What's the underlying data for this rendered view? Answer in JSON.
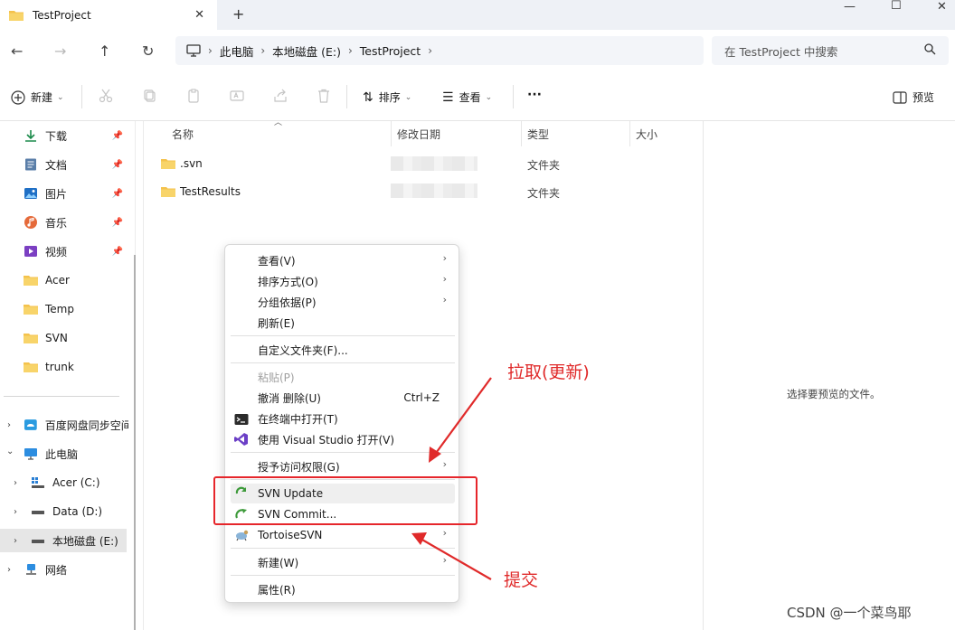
{
  "window": {
    "tab_title": "TestProject",
    "close_tab_glyph": "✕",
    "new_tab_glyph": "+",
    "minimize_glyph": "—",
    "maximize_glyph": "☐",
    "close_glyph": "✕"
  },
  "nav": {
    "back_glyph": "←",
    "forward_glyph": "→",
    "up_glyph": "↑",
    "refresh_glyph": "↻",
    "breadcrumbs": [
      "此电脑",
      "本地磁盘 (E:)",
      "TestProject"
    ],
    "search_placeholder": "在 TestProject 中搜索"
  },
  "toolbar": {
    "new_label": "新建",
    "sort_label": "排序",
    "view_label": "查看",
    "more_label": "···",
    "preview_label": "预览"
  },
  "sidebar": {
    "quick": [
      {
        "label": "下载",
        "icon": "download-icon",
        "pinned": true
      },
      {
        "label": "文档",
        "icon": "document-icon",
        "pinned": true
      },
      {
        "label": "图片",
        "icon": "pictures-icon",
        "pinned": true
      },
      {
        "label": "音乐",
        "icon": "music-icon",
        "pinned": true
      },
      {
        "label": "视频",
        "icon": "video-icon",
        "pinned": true
      },
      {
        "label": "Acer",
        "icon": "folder-icon",
        "pinned": false
      },
      {
        "label": "Temp",
        "icon": "folder-icon",
        "pinned": false
      },
      {
        "label": "SVN",
        "icon": "folder-icon",
        "pinned": false
      },
      {
        "label": "trunk",
        "icon": "folder-icon",
        "pinned": false
      }
    ],
    "tree": [
      {
        "label": "百度网盘同步空间",
        "icon": "cloud-sync-icon",
        "expander": "›"
      },
      {
        "label": "此电脑",
        "icon": "computer-icon",
        "expander": "⌄"
      },
      {
        "label": "Acer (C:)",
        "icon": "windows-drive-icon",
        "expander": "›"
      },
      {
        "label": "Data (D:)",
        "icon": "drive-icon",
        "expander": "›"
      },
      {
        "label": "本地磁盘 (E:)",
        "icon": "drive-icon",
        "expander": "›"
      },
      {
        "label": "网络",
        "icon": "network-icon",
        "expander": "›"
      }
    ]
  },
  "columns": {
    "name": "名称",
    "modified": "修改日期",
    "type": "类型",
    "size": "大小"
  },
  "files": [
    {
      "name": ".svn",
      "type": "文件夹"
    },
    {
      "name": "TestResults",
      "type": "文件夹"
    }
  ],
  "preview": {
    "empty_text": "选择要预览的文件。"
  },
  "context_menu": {
    "view": "查看(V)",
    "sort_by": "排序方式(O)",
    "group_by": "分组依据(P)",
    "refresh": "刷新(E)",
    "customize": "自定义文件夹(F)...",
    "paste": "粘贴(P)",
    "undo": "撤消 删除(U)",
    "undo_shortcut": "Ctrl+Z",
    "open_terminal": "在终端中打开(T)",
    "open_vs": "使用 Visual Studio 打开(V)",
    "grant_access": "授予访问权限(G)",
    "svn_update": "SVN Update",
    "svn_commit": "SVN Commit...",
    "tortoise": "TortoiseSVN",
    "new": "新建(W)",
    "properties": "属性(R)",
    "submenu_glyph": "›"
  },
  "annotations": {
    "pull": "拉取(更新)",
    "commit": "提交",
    "color": "#e02a2a"
  },
  "watermark": "CSDN @一个菜鸟耶"
}
